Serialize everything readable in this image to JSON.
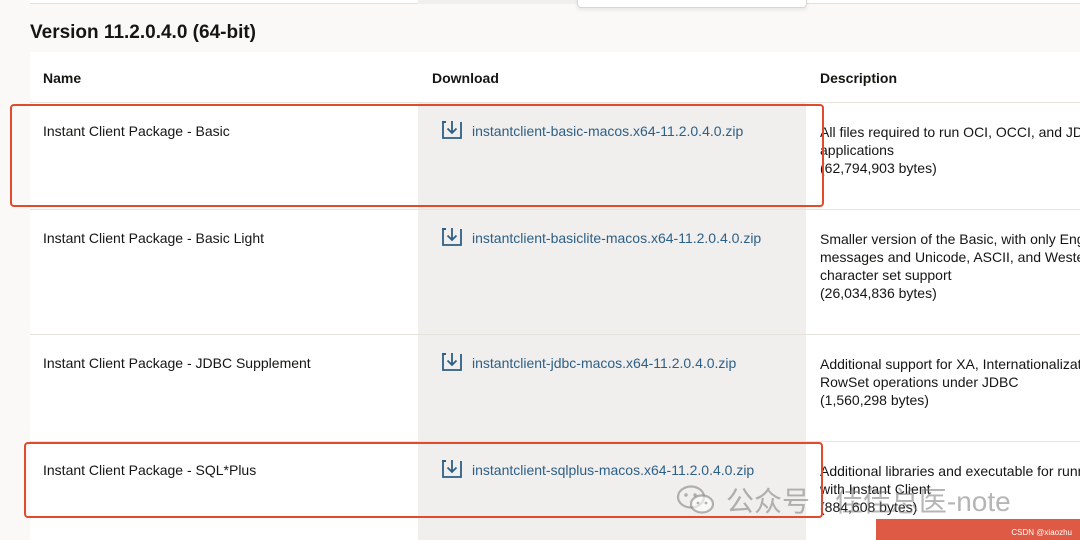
{
  "version_heading": "Version 11.2.0.4.0 (64-bit)",
  "table": {
    "headers": {
      "name": "Name",
      "download": "Download",
      "description": "Description"
    },
    "rows": [
      {
        "name": "Instant Client Package - Basic",
        "file": "instantclient-basic-macos.x64-11.2.0.4.0.zip",
        "desc": [
          "All files required to run OCI, OCCI, and JDBC-OCI",
          "applications",
          "(62,794,903 bytes)"
        ]
      },
      {
        "name": "Instant Client Package - Basic Light",
        "file": "instantclient-basiclite-macos.x64-11.2.0.4.0.zip",
        "desc": [
          "Smaller version of the Basic, with only English error",
          "messages and Unicode, ASCII, and Western European",
          "character set support",
          "(26,034,836 bytes)"
        ]
      },
      {
        "name": "Instant Client Package - JDBC Supplement",
        "file": "instantclient-jdbc-macos.x64-11.2.0.4.0.zip",
        "desc": [
          "Additional support for XA, Internationalization, and",
          "RowSet operations under JDBC",
          "(1,560,298 bytes)"
        ]
      },
      {
        "name": "Instant Client Package - SQL*Plus",
        "file": "instantclient-sqlplus-macos.x64-11.2.0.4.0.zip",
        "desc": [
          "Additional libraries and executable for running SQL*Plus",
          "with Instant Client",
          "(884,608 bytes)"
        ]
      }
    ]
  },
  "watermark": "公众号 · 佳佳总医-note",
  "corner_text": "CSDN @xiaozhu",
  "icons": {
    "download": "download-icon",
    "watermark": "wechat-icon"
  },
  "colors": {
    "link": "#2c5f86",
    "highlight": "#e24a2d",
    "corner": "#df5a44"
  }
}
